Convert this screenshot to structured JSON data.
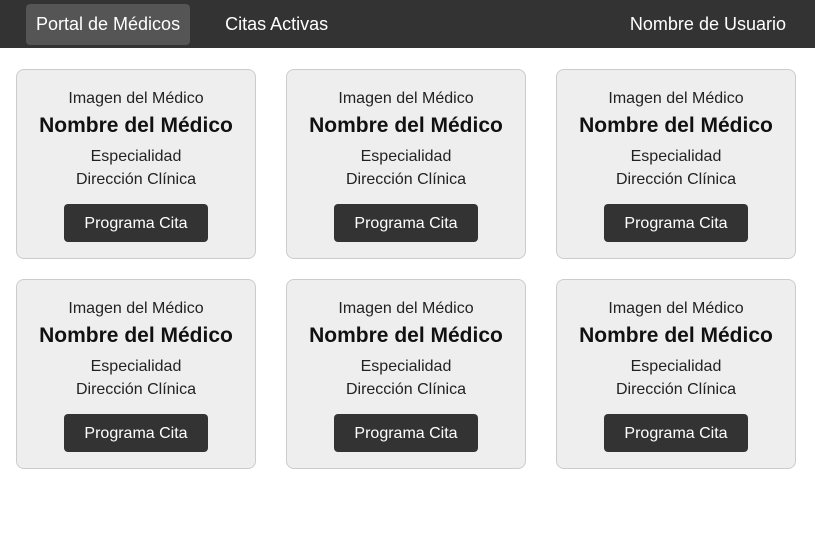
{
  "navbar": {
    "brand_label": "Portal de Médicos",
    "link_label": "Citas Activas",
    "user_label": "Nombre de Usuario"
  },
  "doctors": [
    {
      "image_text": "Imagen del Médico",
      "name": "Nombre del Médico",
      "specialty": "Especialidad",
      "address": "Dirección Clínica",
      "button_label": "Programa Cita"
    },
    {
      "image_text": "Imagen del Médico",
      "name": "Nombre del Médico",
      "specialty": "Especialidad",
      "address": "Dirección Clínica",
      "button_label": "Programa Cita"
    },
    {
      "image_text": "Imagen del Médico",
      "name": "Nombre del Médico",
      "specialty": "Especialidad",
      "address": "Dirección Clínica",
      "button_label": "Programa Cita"
    },
    {
      "image_text": "Imagen del Médico",
      "name": "Nombre del Médico",
      "specialty": "Especialidad",
      "address": "Dirección Clínica",
      "button_label": "Programa Cita"
    },
    {
      "image_text": "Imagen del Médico",
      "name": "Nombre del Médico",
      "specialty": "Especialidad",
      "address": "Dirección Clínica",
      "button_label": "Programa Cita"
    },
    {
      "image_text": "Imagen del Médico",
      "name": "Nombre del Médico",
      "specialty": "Especialidad",
      "address": "Dirección Clínica",
      "button_label": "Programa Cita"
    }
  ],
  "colors": {
    "navbar_bg": "#333333",
    "nav_active_bg": "#555555",
    "card_bg": "#eeeeee",
    "card_border": "#cccccc",
    "button_bg": "#333333",
    "button_text": "#ffffff"
  }
}
